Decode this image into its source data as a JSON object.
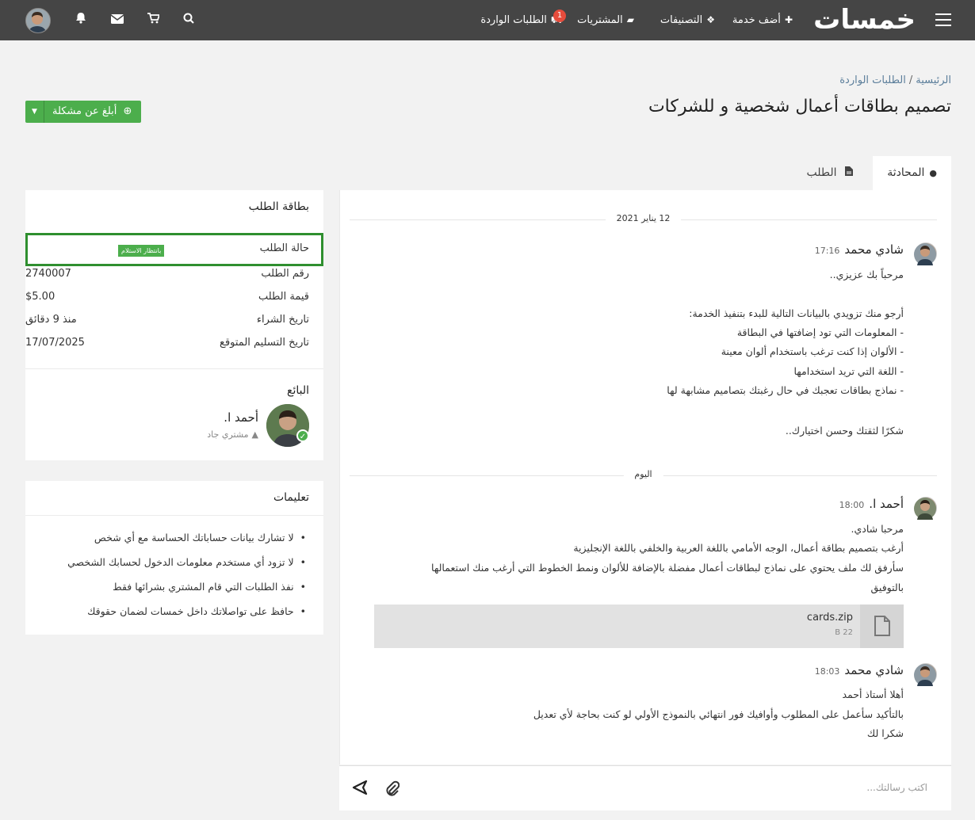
{
  "nav": {
    "logo": "خمسات",
    "add_service": "أضف خدمة",
    "categories": "التصنيفات",
    "purchases": "المشتريات",
    "incoming_requests": "الطلبات الواردة",
    "incoming_badge": "1"
  },
  "breadcrumb": {
    "home": "الرئيسية",
    "separator": "/",
    "current": "الطلبات الواردة"
  },
  "page": {
    "title": "تصميم بطاقات أعمال شخصية و للشركات",
    "report_button": "أبلغ عن مشكلة"
  },
  "tabs": {
    "conversation": "المحادثة",
    "order": "الطلب"
  },
  "chat": {
    "date1": "12 يناير 2021",
    "date2": "اليوم",
    "messages": [
      {
        "author": "شادي محمد",
        "time": "17:16",
        "lines": [
          "مرحباً بك عزيزي..",
          "أرجو منك تزويدي بالبيانات التالية للبدء بتنفيذ الخدمة:",
          "- المعلومات التي تود إضافتها في البطاقة",
          "- الألوان إذا كنت ترغب باستخدام ألوان معينة",
          "- اللغة التي تريد استخدامها",
          "- نماذج بطاقات تعجبك في حال رغبتك بتصاميم مشابهة لها",
          "شكرًا لثقتك وحسن اختيارك.."
        ]
      },
      {
        "author": "أحمد ا.",
        "time": "18:00",
        "lines": [
          "مرحبا شادي.",
          "أرغب بتصميم بطاقة أعمال، الوجه الأمامي باللغة العربية والخلفي باللغة الإنجليزية",
          "سأرفق لك ملف يحتوي على نماذج لبطاقات أعمال مفضلة بالإضافة للألوان ونمط الخطوط التي أرغب منك استعمالها",
          "بالتوفيق"
        ],
        "attachment": {
          "name": "cards.zip",
          "size": "22 B"
        }
      },
      {
        "author": "شادي محمد",
        "time": "18:03",
        "lines": [
          "أهلا أستاذ أحمد",
          "بالتأكيد سأعمل على المطلوب وأوافيك فور انتهائي بالنموذج الأولي لو كنت بحاجة لأي تعديل",
          "شكرا لك"
        ]
      }
    ],
    "composer_placeholder": "اكتب رسالتك..."
  },
  "order_card": {
    "title": "بطاقة الطلب",
    "status_label": "حالة الطلب",
    "status_value": "بانتظار الاستلام",
    "number_label": "رقم الطلب",
    "number_value": "2740007",
    "price_label": "قيمة الطلب",
    "price_value": "$5.00",
    "purchase_label": "تاريخ الشراء",
    "purchase_value": "منذ 9 دقائق",
    "delivery_label": "تاريخ التسليم المتوقع",
    "delivery_value": "17/07/2025",
    "seller_heading": "البائع",
    "seller_name": "أحمد ا.",
    "seller_role": "مشتري جاد"
  },
  "instructions": {
    "title": "تعليمات",
    "items": [
      "لا تشارك بيانات حساباتك الحساسة مع أي شخص",
      "لا تزود أي مستخدم معلومات الدخول لحسابك الشخصي",
      "نفذ الطلبات التي قام المشتري بشرائها فقط",
      "حافظ على تواصلاتك داخل خمسات لضمان حقوقك"
    ]
  },
  "colors": {
    "topbar": "#454545",
    "accent_green": "#4cae4c",
    "status_border": "#2f8f2f",
    "logo_accent": "#f5a623"
  }
}
